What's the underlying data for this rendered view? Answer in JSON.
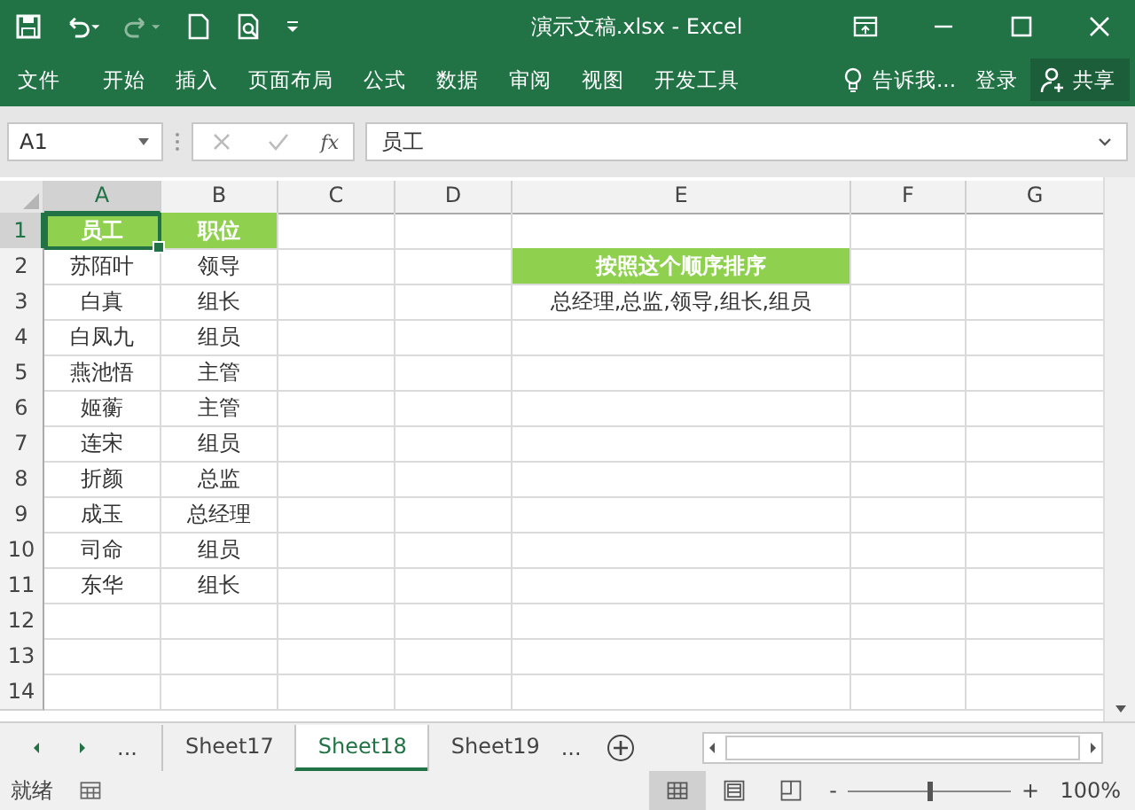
{
  "window": {
    "title": "演示文稿.xlsx - Excel"
  },
  "ribbon_tabs": [
    {
      "label": "文件"
    },
    {
      "label": "开始"
    },
    {
      "label": "插入"
    },
    {
      "label": "页面布局"
    },
    {
      "label": "公式"
    },
    {
      "label": "数据"
    },
    {
      "label": "审阅"
    },
    {
      "label": "视图"
    },
    {
      "label": "开发工具"
    }
  ],
  "tell_me": "告诉我...",
  "sign_in": "登录",
  "share": "共享",
  "formula_bar": {
    "name_box": "A1",
    "fx": "fx",
    "value": "员工"
  },
  "columns": [
    {
      "label": "A",
      "selected": true
    },
    {
      "label": "B",
      "selected": false
    },
    {
      "label": "C",
      "selected": false
    },
    {
      "label": "D",
      "selected": false
    },
    {
      "label": "E",
      "selected": false
    },
    {
      "label": "F",
      "selected": false
    },
    {
      "label": "G",
      "selected": false
    }
  ],
  "rows": [
    {
      "number": "1",
      "selected": true,
      "kind": "header",
      "cells": [
        "员工",
        "职位"
      ]
    },
    {
      "number": "2",
      "selected": false,
      "kind": "plain",
      "cells": [
        "苏陌叶",
        "领导"
      ]
    },
    {
      "number": "3",
      "selected": false,
      "kind": "plain",
      "cells": [
        "白真",
        "组长"
      ]
    },
    {
      "number": "4",
      "selected": false,
      "kind": "plain",
      "cells": [
        "白凤九",
        "组员"
      ]
    },
    {
      "number": "5",
      "selected": false,
      "kind": "plain",
      "cells": [
        "燕池悟",
        "主管"
      ]
    },
    {
      "number": "6",
      "selected": false,
      "kind": "plain",
      "cells": [
        "姬蘅",
        "主管"
      ]
    },
    {
      "number": "7",
      "selected": false,
      "kind": "plain",
      "cells": [
        "连宋",
        "组员"
      ]
    },
    {
      "number": "8",
      "selected": false,
      "kind": "plain",
      "cells": [
        "折颜",
        "总监"
      ]
    },
    {
      "number": "9",
      "selected": false,
      "kind": "plain",
      "cells": [
        "成玉",
        "总经理"
      ]
    },
    {
      "number": "10",
      "selected": false,
      "kind": "plain",
      "cells": [
        "司命",
        "组员"
      ]
    },
    {
      "number": "11",
      "selected": false,
      "kind": "plain",
      "cells": [
        "东华",
        "组长"
      ]
    },
    {
      "number": "12",
      "selected": false
    },
    {
      "number": "13",
      "selected": false
    },
    {
      "number": "14",
      "selected": false
    }
  ],
  "side_note": {
    "heading": "按照这个顺序排序",
    "text": "总经理,总监,领导,组长,组员"
  },
  "sheet_tabs": {
    "more_left": "...",
    "tabs": [
      {
        "label": "Sheet17",
        "selected": false
      },
      {
        "label": "Sheet18",
        "selected": true
      },
      {
        "label": "Sheet19",
        "selected": false
      }
    ],
    "more_right": "..."
  },
  "status_bar": {
    "status": "就绪",
    "views": [
      {
        "kind": "normal",
        "selected": true
      },
      {
        "kind": "layout",
        "selected": false
      },
      {
        "kind": "pagebreak",
        "selected": false
      }
    ],
    "zoom_out": "-",
    "zoom_in": "+",
    "zoom": "100%",
    "level": 0.5
  }
}
